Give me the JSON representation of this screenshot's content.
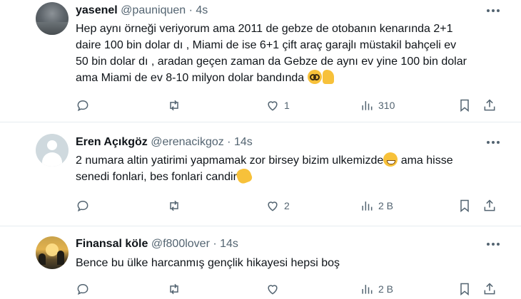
{
  "tweets": [
    {
      "name": "yasenel",
      "handle": "@pauniquen",
      "sep": " · ",
      "time": "4s",
      "lines": [
        "Hep aynı örneği veriyorum ama 2011 de gebze de otobanın kenarında 2+1",
        "daire 100 bin dolar dı , Miami de ise 6+1 çift araç garajlı müstakil bahçeli ev",
        "50 bin dolar dı , aradan geçen zaman da Gebze de aynı ev yine 100 bin dolar",
        "ama Miami de ev 8-10 milyon dolar bandında"
      ],
      "emojis": [
        "nerd-face-emoji",
        "thumbs-up-emoji"
      ],
      "stats": {
        "replies": "",
        "retweets": "",
        "likes": "1",
        "views": "310"
      }
    },
    {
      "name": "Eren Açıkgöz",
      "handle": "@erenacikgoz",
      "sep": " · ",
      "time": "14s",
      "lines": [
        "2 numara altin yatirimi yapmamak zor birsey bizim ulkemizde",
        " ama hisse",
        "senedi fonlari, bes fonlari candir"
      ],
      "emojis": [
        "grinning-face-emoji",
        "clapping-hands-emoji"
      ],
      "stats": {
        "replies": "",
        "retweets": "",
        "likes": "2",
        "views": "2 B"
      }
    },
    {
      "name": "Finansal köle",
      "handle": "@f800lover",
      "sep": " · ",
      "time": "14s",
      "lines": [
        "Bence bu ülke harcanmış gençlik hikayesi hepsi boş"
      ],
      "emojis": [],
      "stats": {
        "replies": "",
        "retweets": "",
        "likes": "",
        "views": "2 B"
      }
    }
  ],
  "icons": {
    "reply": "reply-icon",
    "retweet": "retweet-icon",
    "like": "heart-icon",
    "views": "views-chart-icon",
    "bookmark": "bookmark-icon",
    "share": "share-icon",
    "more": "more-horizontal-icon"
  },
  "colors": {
    "text": "#0f1419",
    "secondary": "#536471",
    "divider": "#e6ecf0"
  }
}
